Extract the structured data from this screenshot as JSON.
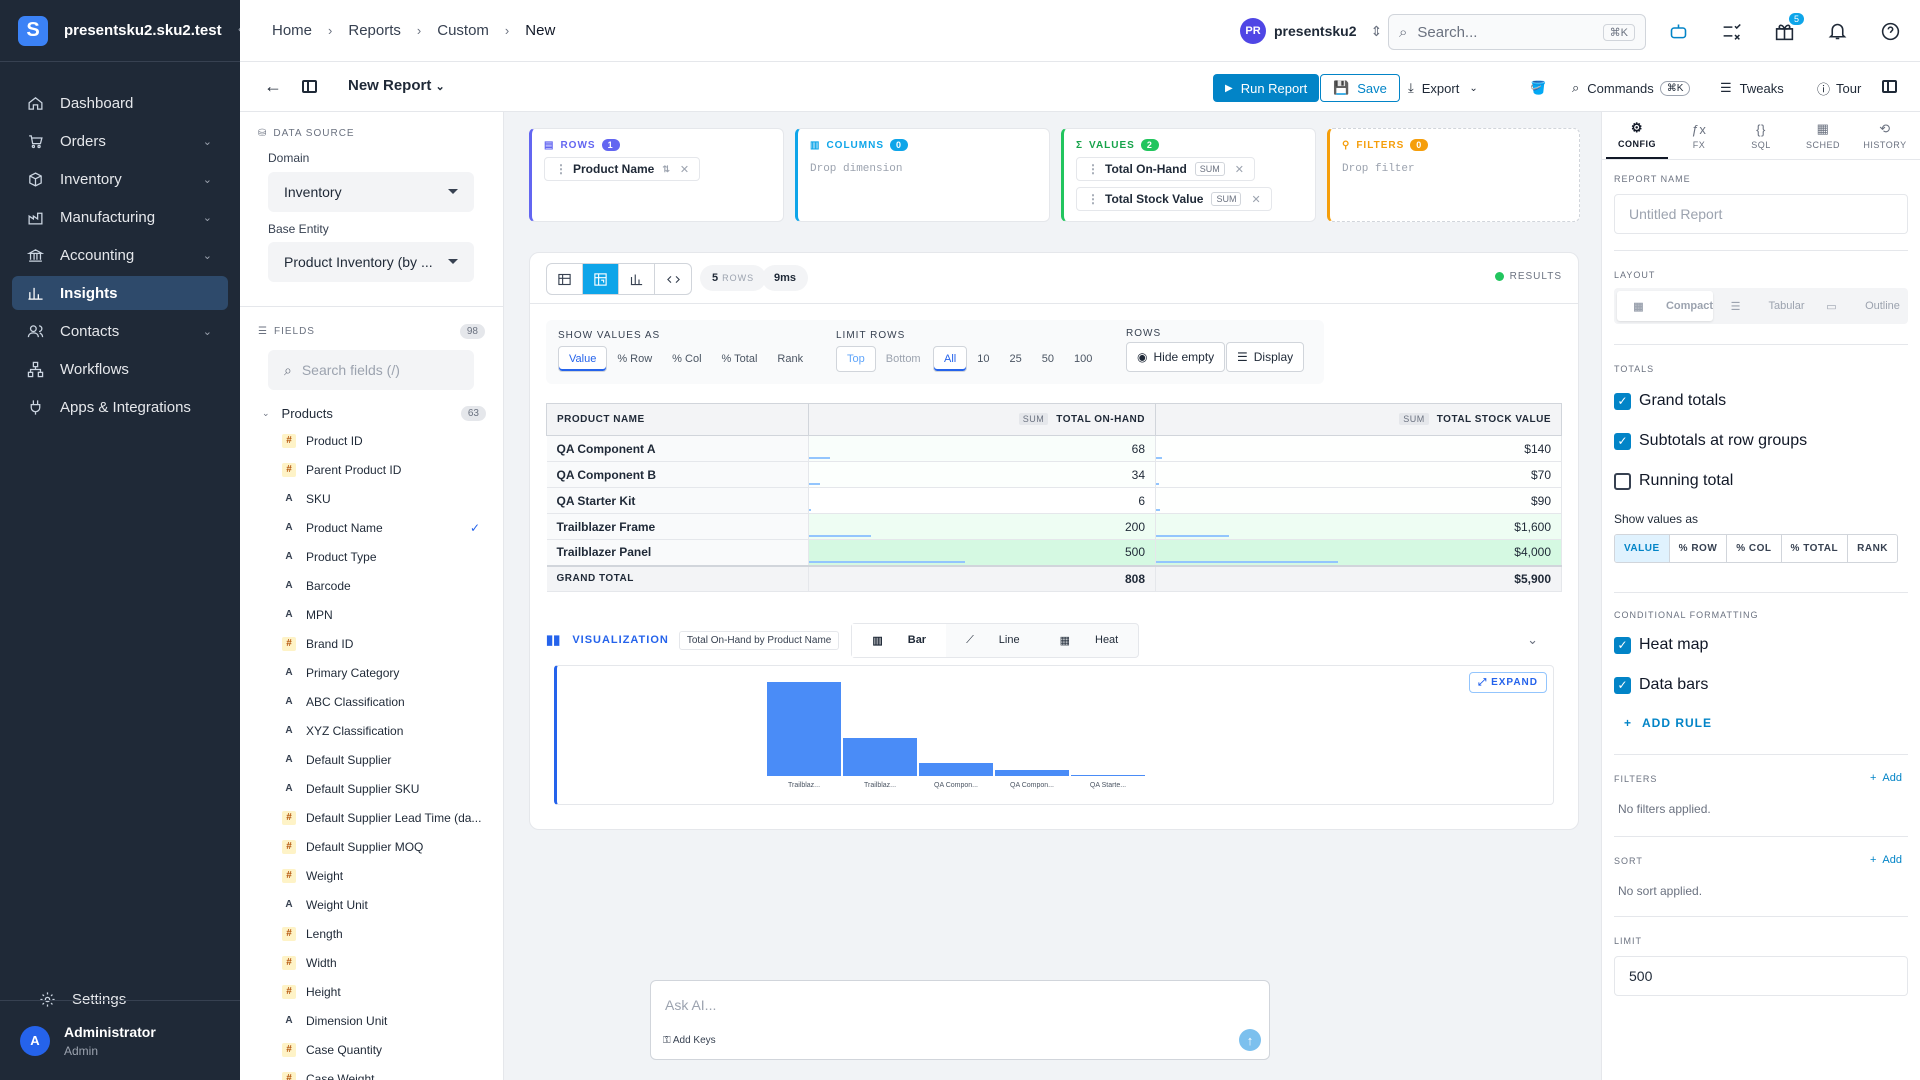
{
  "app": {
    "site": "presentsku2.sku2.test",
    "logo_letter": "S"
  },
  "sidebar": {
    "items": [
      {
        "label": "Dashboard",
        "icon": "home-icon"
      },
      {
        "label": "Orders",
        "icon": "cart-icon"
      },
      {
        "label": "Inventory",
        "icon": "box-icon"
      },
      {
        "label": "Manufacturing",
        "icon": "factory-icon"
      },
      {
        "label": "Accounting",
        "icon": "bank-icon"
      },
      {
        "label": "Insights",
        "icon": "chart-icon"
      },
      {
        "label": "Contacts",
        "icon": "contacts-icon"
      },
      {
        "label": "Workflows",
        "icon": "workflow-icon"
      },
      {
        "label": "Apps & Integrations",
        "icon": "plug-icon"
      }
    ],
    "settings": "Settings",
    "user": {
      "initial": "A",
      "name": "Administrator",
      "role": "Admin"
    }
  },
  "topbar": {
    "breadcrumbs": [
      "Home",
      "Reports",
      "Custom",
      "New"
    ],
    "workspace": {
      "initials": "PR",
      "name": "presentsku2"
    },
    "search_placeholder": "Search...",
    "search_kbd": "⌘K",
    "gift_badge": "5"
  },
  "subbar": {
    "report_title": "New Report",
    "run": "Run Report",
    "save": "Save",
    "export": "Export",
    "commands": "Commands",
    "commands_kbd": "⌘K",
    "tweaks": "Tweaks",
    "tour": "Tour"
  },
  "left": {
    "data_source": "DATA SOURCE",
    "domain_label": "Domain",
    "domain_value": "Inventory",
    "entity_label": "Base Entity",
    "entity_value": "Product Inventory (by ...",
    "fields_label": "FIELDS",
    "fields_count": "98",
    "search_placeholder": "Search fields (/)",
    "group": "Products",
    "group_count": "63",
    "fields": [
      {
        "type": "#",
        "name": "Product ID"
      },
      {
        "type": "#",
        "name": "Parent Product ID"
      },
      {
        "type": "A",
        "name": "SKU"
      },
      {
        "type": "A",
        "name": "Product Name",
        "checked": true
      },
      {
        "type": "A",
        "name": "Product Type"
      },
      {
        "type": "A",
        "name": "Barcode"
      },
      {
        "type": "A",
        "name": "MPN"
      },
      {
        "type": "#",
        "name": "Brand ID"
      },
      {
        "type": "A",
        "name": "Primary Category"
      },
      {
        "type": "A",
        "name": "ABC Classification"
      },
      {
        "type": "A",
        "name": "XYZ Classification"
      },
      {
        "type": "A",
        "name": "Default Supplier"
      },
      {
        "type": "A",
        "name": "Default Supplier SKU"
      },
      {
        "type": "#",
        "name": "Default Supplier Lead Time (da..."
      },
      {
        "type": "#",
        "name": "Default Supplier MOQ"
      },
      {
        "type": "#",
        "name": "Weight"
      },
      {
        "type": "A",
        "name": "Weight Unit"
      },
      {
        "type": "#",
        "name": "Length"
      },
      {
        "type": "#",
        "name": "Width"
      },
      {
        "type": "#",
        "name": "Height"
      },
      {
        "type": "A",
        "name": "Dimension Unit"
      },
      {
        "type": "#",
        "name": "Case Quantity"
      },
      {
        "type": "#",
        "name": "Case Weight"
      }
    ]
  },
  "zones": {
    "rows": {
      "label": "ROWS",
      "count": "1",
      "chips": [
        "Product Name"
      ]
    },
    "columns": {
      "label": "COLUMNS",
      "count": "0",
      "placeholder": "Drop dimension"
    },
    "values": {
      "label": "VALUES",
      "count": "2",
      "chips": [
        {
          "name": "Total On-Hand",
          "agg": "SUM"
        },
        {
          "name": "Total Stock Value",
          "agg": "SUM"
        }
      ]
    },
    "filters": {
      "label": "FILTERS",
      "count": "0",
      "placeholder": "Drop filter"
    }
  },
  "results": {
    "rows_stat": "5",
    "rows_unit": "ROWS",
    "time_stat": "9ms",
    "status": "RESULTS",
    "show_values_label": "SHOW VALUES AS",
    "show_values": [
      "Value",
      "% Row",
      "% Col",
      "% Total",
      "Rank"
    ],
    "limit_label": "LIMIT ROWS",
    "limit_dir": [
      "Top",
      "Bottom"
    ],
    "limit_opts": [
      "All",
      "10",
      "25",
      "50",
      "100"
    ],
    "rows_label": "ROWS",
    "hide_empty": "Hide empty",
    "display": "Display",
    "table": {
      "headers": [
        "PRODUCT NAME",
        "TOTAL ON-HAND",
        "TOTAL STOCK VALUE"
      ],
      "agg_tag": "SUM",
      "rows": [
        {
          "name": "QA Component A",
          "onhand": "68",
          "value": "$140",
          "onhand_n": 68,
          "value_n": 140
        },
        {
          "name": "QA Component B",
          "onhand": "34",
          "value": "$70",
          "onhand_n": 34,
          "value_n": 70
        },
        {
          "name": "QA Starter Kit",
          "onhand": "6",
          "value": "$90",
          "onhand_n": 6,
          "value_n": 90
        },
        {
          "name": "Trailblazer Frame",
          "onhand": "200",
          "value": "$1,600",
          "onhand_n": 200,
          "value_n": 1600
        },
        {
          "name": "Trailblazer Panel",
          "onhand": "500",
          "value": "$4,000",
          "onhand_n": 500,
          "value_n": 4000
        }
      ],
      "total": {
        "label": "GRAND TOTAL",
        "onhand": "808",
        "value": "$5,900"
      }
    }
  },
  "viz": {
    "title": "VISUALIZATION",
    "subtitle": "Total On-Hand by Product Name",
    "types": [
      "Bar",
      "Line",
      "Heat"
    ],
    "expand": "EXPAND"
  },
  "chart_data": {
    "type": "bar",
    "categories": [
      "Trailblaz...",
      "Trailblaz...",
      "QA Compon...",
      "QA Compon...",
      "QA Starte..."
    ],
    "values": [
      500,
      200,
      68,
      34,
      6
    ],
    "title": "Total On-Hand by Product Name",
    "xlabel": "",
    "ylabel": "",
    "ylim": [
      0,
      500
    ],
    "color": "#4a8cf7"
  },
  "ask": {
    "placeholder": "Ask AI...",
    "keys": "Add Keys"
  },
  "right": {
    "tabs": [
      {
        "label": "CONFIG",
        "glyph": "⚙"
      },
      {
        "label": "FX",
        "glyph": "ƒx"
      },
      {
        "label": "SQL",
        "glyph": "{}"
      },
      {
        "label": "SCHED",
        "glyph": "▦"
      },
      {
        "label": "HISTORY",
        "glyph": "⟲"
      }
    ],
    "report_name_label": "REPORT NAME",
    "report_name_placeholder": "Untitled Report",
    "layout_label": "LAYOUT",
    "layouts": [
      "Compact",
      "Tabular",
      "Outline"
    ],
    "totals_label": "TOTALS",
    "totals": [
      {
        "label": "Grand totals",
        "on": true
      },
      {
        "label": "Subtotals at row groups",
        "on": true
      },
      {
        "label": "Running total",
        "on": false
      }
    ],
    "show_values_label": "Show values as",
    "show_values": [
      "VALUE",
      "% ROW",
      "% COL",
      "% TOTAL",
      "RANK"
    ],
    "cond_label": "CONDITIONAL FORMATTING",
    "cond": [
      {
        "label": "Heat map",
        "on": true
      },
      {
        "label": "Data bars",
        "on": true
      }
    ],
    "add_rule": "ADD RULE",
    "filters_label": "FILTERS",
    "filters_add": "Add",
    "filters_empty": "No filters applied.",
    "sort_label": "SORT",
    "sort_add": "Add",
    "sort_empty": "No sort applied.",
    "limit_label": "LIMIT",
    "limit_value": "500"
  },
  "colors": {
    "accent": "#0284c7",
    "sidebar": "#1f2937",
    "active_nav": "#2e4a6b",
    "bar": "#4a8cf7"
  }
}
